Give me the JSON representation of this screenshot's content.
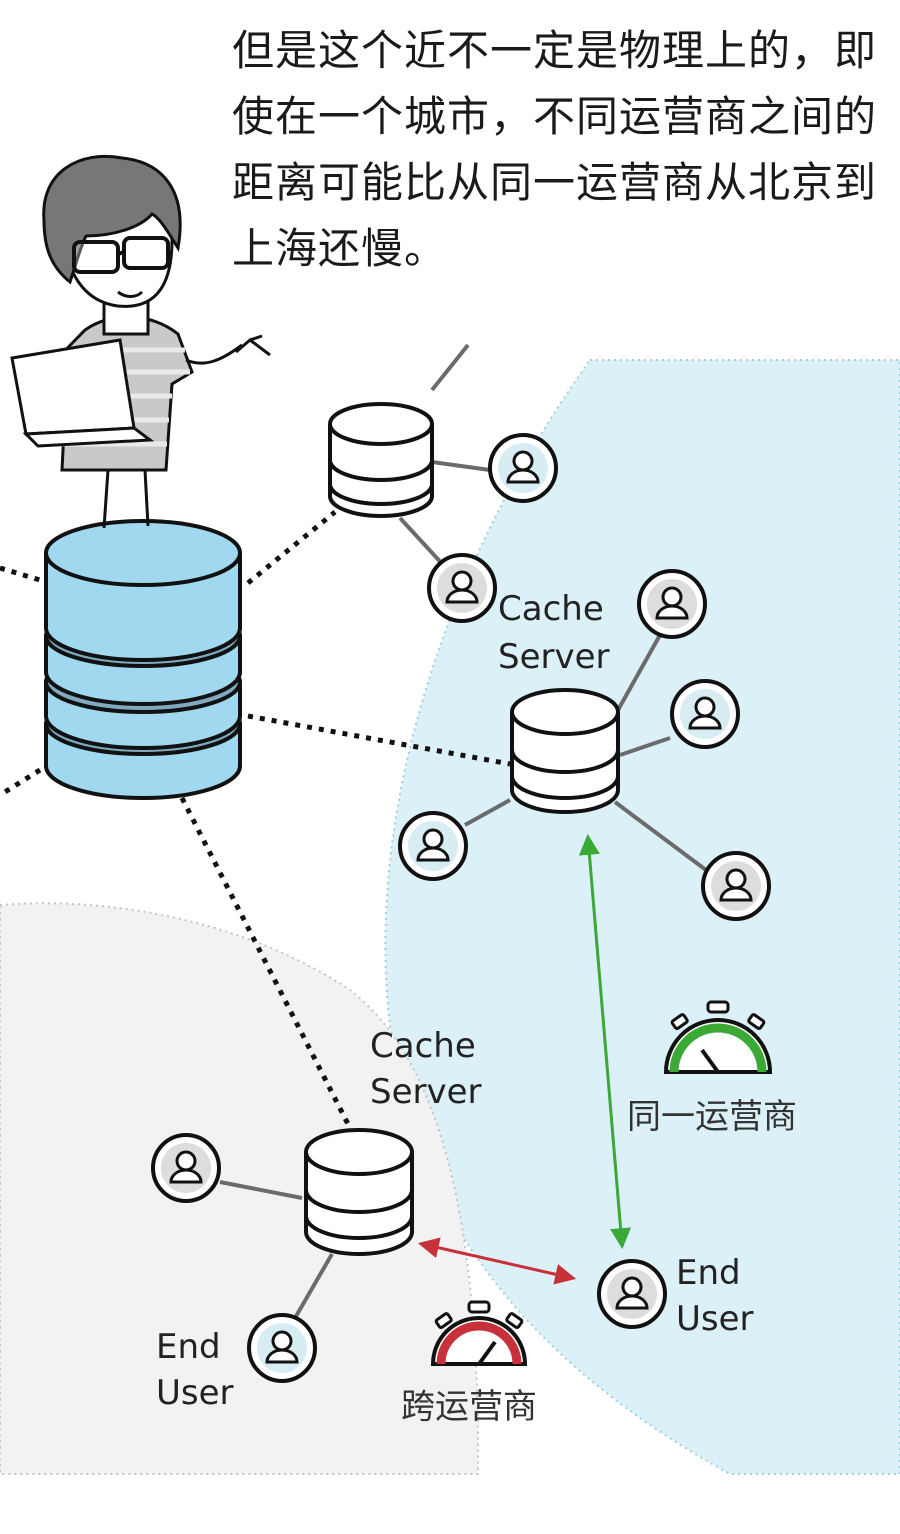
{
  "caption": "但是这个近不一定是物理上的，即使在一个城市，不同运营商之间的距离可能比从同一运营商从北京到上海还慢。",
  "nodes": {
    "cache_server_top": {
      "line1": "Cache",
      "line2": "Server"
    },
    "cache_server_bottom": {
      "line1": "Cache",
      "line2": "Server"
    },
    "end_user_right": {
      "line1": "End",
      "line2": "User"
    },
    "end_user_left": {
      "line1": "End",
      "line2": "User"
    }
  },
  "timers": {
    "same_isp": {
      "label": "同一运营商",
      "color": "#3aa935"
    },
    "cross_isp": {
      "label": "跨运营商",
      "color": "#c8303a"
    }
  },
  "colors": {
    "isp_region_blue": "#dcf0f8",
    "isp_region_gray": "#f2f2f2",
    "origin_db": "#9fd8ef",
    "same_isp_arrow": "#3aa935",
    "cross_isp_arrow": "#c8303a"
  }
}
